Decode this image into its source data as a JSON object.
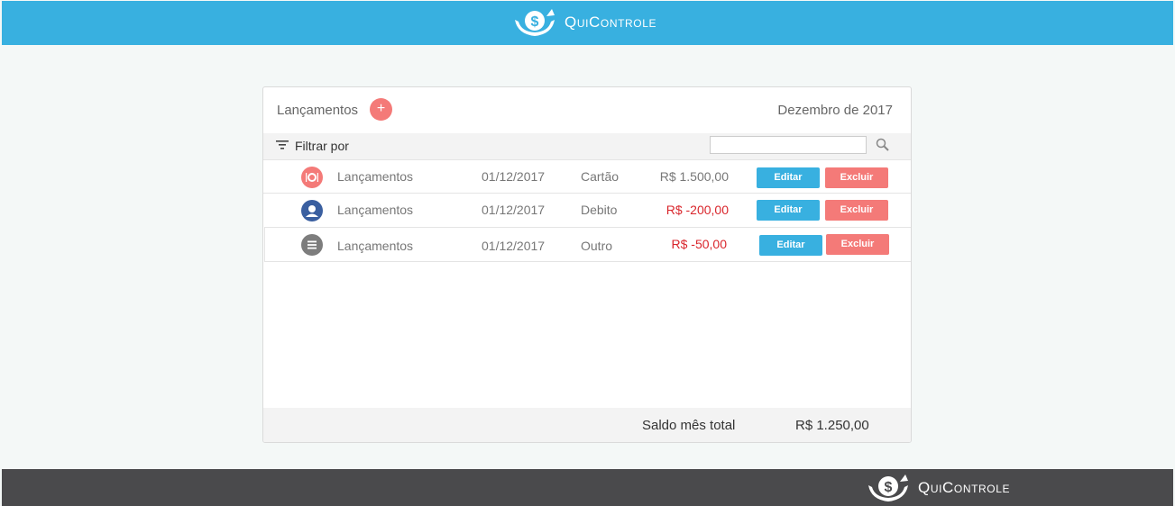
{
  "app": {
    "name": "QuiControle"
  },
  "colors": {
    "primary": "#38b0e0",
    "danger": "#f47a78",
    "negative": "#d9262c",
    "footer": "#4a4a4c"
  },
  "card": {
    "title": "Lançamentos",
    "add_label": "+",
    "month": "Dezembro de 2017",
    "filter_label": "Filtrar por",
    "search_placeholder": "",
    "rows": [
      {
        "icon": "dining-icon",
        "description": "Lançamentos",
        "date": "01/12/2017",
        "type": "Cartão",
        "value": "R$ 1.500,00",
        "edit": "Editar",
        "delete": "Excluir"
      },
      {
        "icon": "person-icon",
        "description": "Lançamentos",
        "date": "01/12/2017",
        "type": "Debito",
        "value": "R$ -200,00",
        "edit": "Editar",
        "delete": "Excluir"
      },
      {
        "icon": "list-icon",
        "description": "Lançamentos",
        "date": "01/12/2017",
        "type": "Outro",
        "value": "R$ -50,00",
        "edit": "Editar",
        "delete": "Excluir"
      }
    ],
    "total_label": "Saldo mês total",
    "total_value": "R$ 1.250,00"
  }
}
